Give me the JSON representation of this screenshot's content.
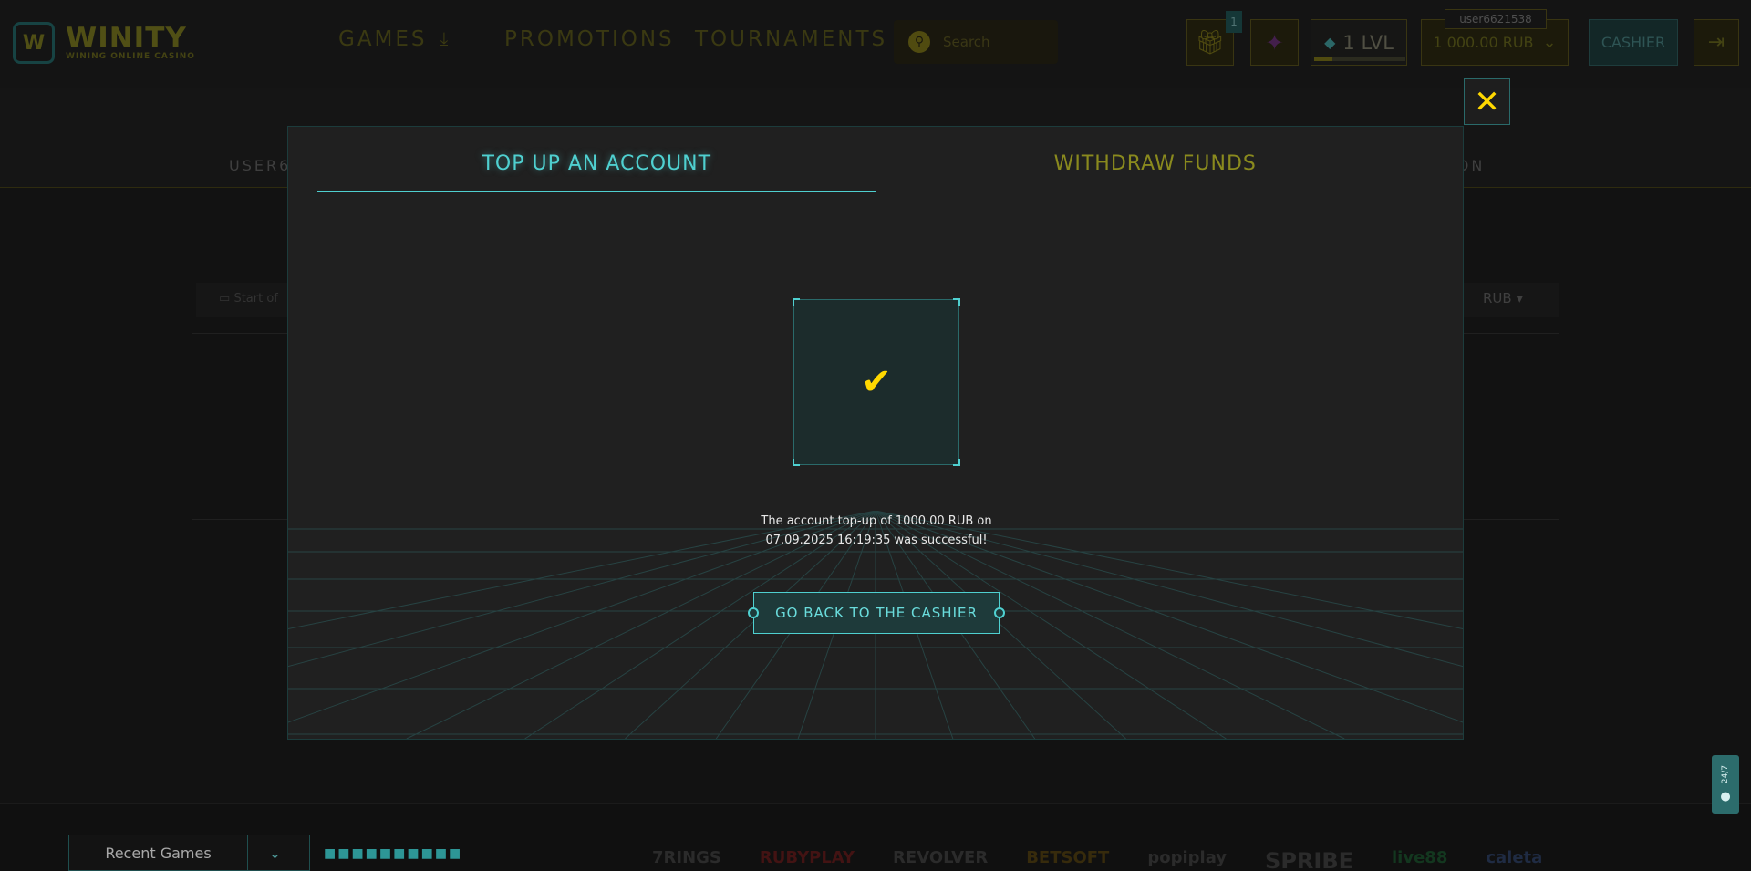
{
  "header": {
    "logo_mark": "W",
    "logo_title": "WINITY",
    "logo_subtitle": "WINING ONLINE CASINO",
    "nav": {
      "games": "GAMES",
      "promotions": "PROMOTIONS",
      "tournaments": "TOURNAMENTS"
    },
    "search_placeholder": "Search",
    "gift_badge": "1",
    "level": "1 LVL",
    "level_progress": 0.2,
    "username": "user6621538",
    "balance": "1 000.00 RUB",
    "cashier": "CASHIER"
  },
  "background": {
    "subnav_left": "USER6",
    "subnav_right": "ION",
    "filter_start": "Start of",
    "currency": "RUB"
  },
  "modal": {
    "tabs": [
      {
        "label": "TOP UP AN ACCOUNT",
        "active": true
      },
      {
        "label": "WITHDRAW FUNDS",
        "active": false
      }
    ],
    "message_line1": "The account top-up of 1000.00 RUB on",
    "message_line2": "07.09.2025 16:19:35 was successful!",
    "back_button": "GO BACK TO THE CASHIER"
  },
  "footer": {
    "recent_games": "Recent Games",
    "providers": [
      "7RINGS",
      "RUBYPLAY",
      "REVOLVER",
      "BETSOFT",
      "popiplay",
      "SPRIBE",
      "live88",
      "caleta"
    ],
    "support_label": "24/7"
  },
  "colors": {
    "accent": "#4fd0d0",
    "gold": "#ffd800",
    "bg": "#181818"
  },
  "icons": {
    "search": "search-icon",
    "gift": "gift-icon",
    "sparkle": "sparkle-icon",
    "diamond": "diamond-icon",
    "logout": "logout-icon",
    "close": "close-icon",
    "check": "check-icon",
    "chevron": "chevron-down-icon",
    "chat": "chat-icon"
  }
}
